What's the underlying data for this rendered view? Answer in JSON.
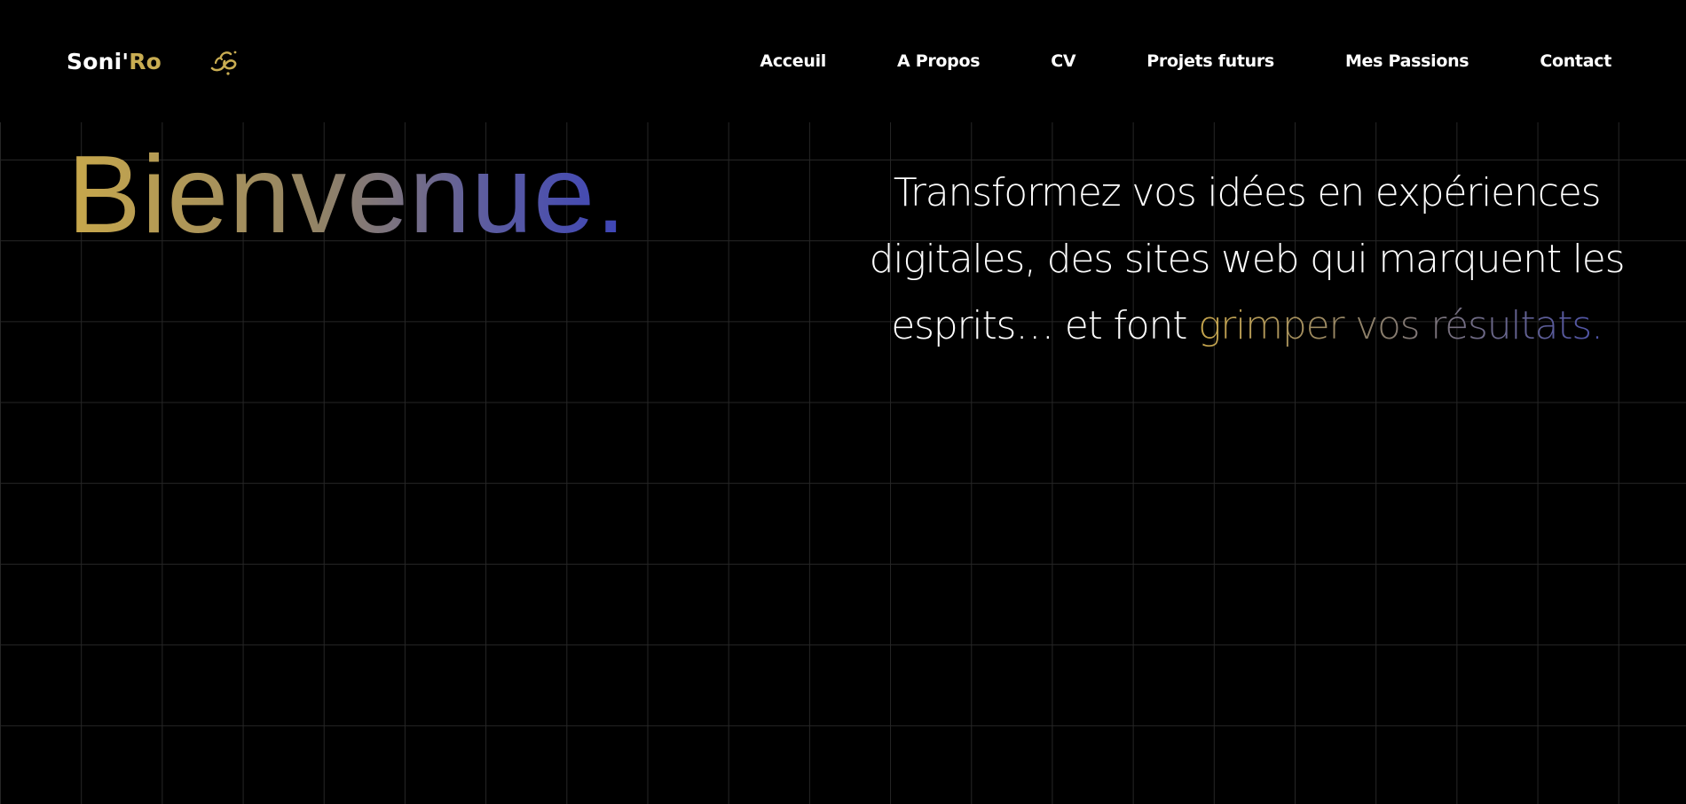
{
  "brand": {
    "name_part1": "Soni'",
    "name_part2": "Ro",
    "logo_icon": "calligraphy-logo-icon",
    "colors": {
      "primary": "#ffffff",
      "accent": "#c9ad52"
    }
  },
  "nav": {
    "items": [
      {
        "label": "Acceuil"
      },
      {
        "label": "A Propos"
      },
      {
        "label": "CV"
      },
      {
        "label": "Projets futurs"
      },
      {
        "label": "Mes Passions"
      },
      {
        "label": "Contact"
      }
    ]
  },
  "hero": {
    "title": "Bienvenue.",
    "title_gradient": [
      "#c8a84b",
      "#928366",
      "#5c5ca0",
      "#3d45b8"
    ],
    "tagline_main": "Transformez vos idées en expériences digitales, des sites web qui marquent les esprits… et font ",
    "tagline_accent": "grimper vos résultats.",
    "tagline_accent_gradient": [
      "#c6a54c",
      "#8a7e6c",
      "#4d52a8"
    ]
  },
  "theme": {
    "background": "#000000",
    "grid_line": "#262626"
  }
}
